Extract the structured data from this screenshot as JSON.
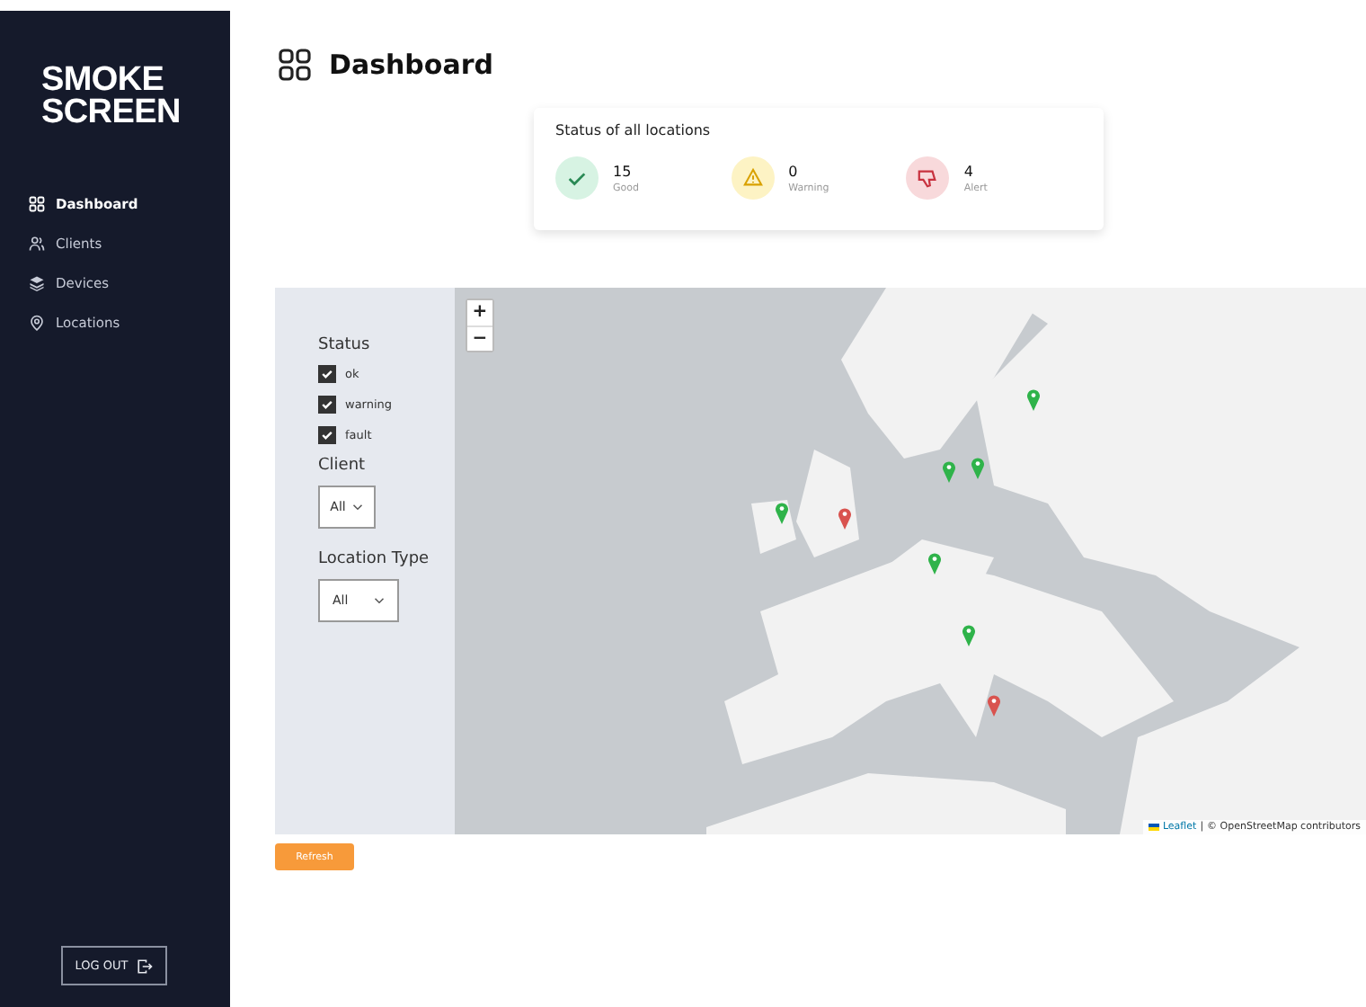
{
  "sidebar": {
    "logo": [
      "SMOKE",
      "SCREEN"
    ],
    "items": [
      {
        "label": "Dashboard",
        "selected": true
      },
      {
        "label": "Clients",
        "selected": false
      },
      {
        "label": "Devices",
        "selected": false
      },
      {
        "label": "Locations",
        "selected": false
      }
    ],
    "logout": "LOG OUT"
  },
  "page": {
    "title": "Dashboard"
  },
  "status_card": {
    "title": "Status of all locations",
    "stats": [
      {
        "kind": "good",
        "count": "15",
        "label": "Good"
      },
      {
        "kind": "warning",
        "count": "0",
        "label": "Warning"
      },
      {
        "kind": "alert",
        "count": "4",
        "label": "Alert"
      }
    ]
  },
  "filters": {
    "status": {
      "title": "Status",
      "options": [
        {
          "label": "ok",
          "checked": true
        },
        {
          "label": "warning",
          "checked": true
        },
        {
          "label": "fault",
          "checked": true
        }
      ]
    },
    "client": {
      "title": "Client",
      "value": "All"
    },
    "location_type": {
      "title": "Location Type",
      "value": "All"
    }
  },
  "map": {
    "zoom_in": "+",
    "zoom_out": "−",
    "attribution": {
      "link": "Leaflet",
      "separator": "|",
      "text": "© OpenStreetMap contributors"
    },
    "pins": [
      {
        "color": "#2fb34a"
      },
      {
        "color": "#2fb34a"
      },
      {
        "color": "#2fb34a"
      },
      {
        "color": "#2fb34a"
      },
      {
        "color": "#d9534f"
      },
      {
        "color": "#2fb34a"
      },
      {
        "color": "#2fb34a"
      },
      {
        "color": "#d9534f"
      }
    ]
  },
  "refresh": "Refresh"
}
